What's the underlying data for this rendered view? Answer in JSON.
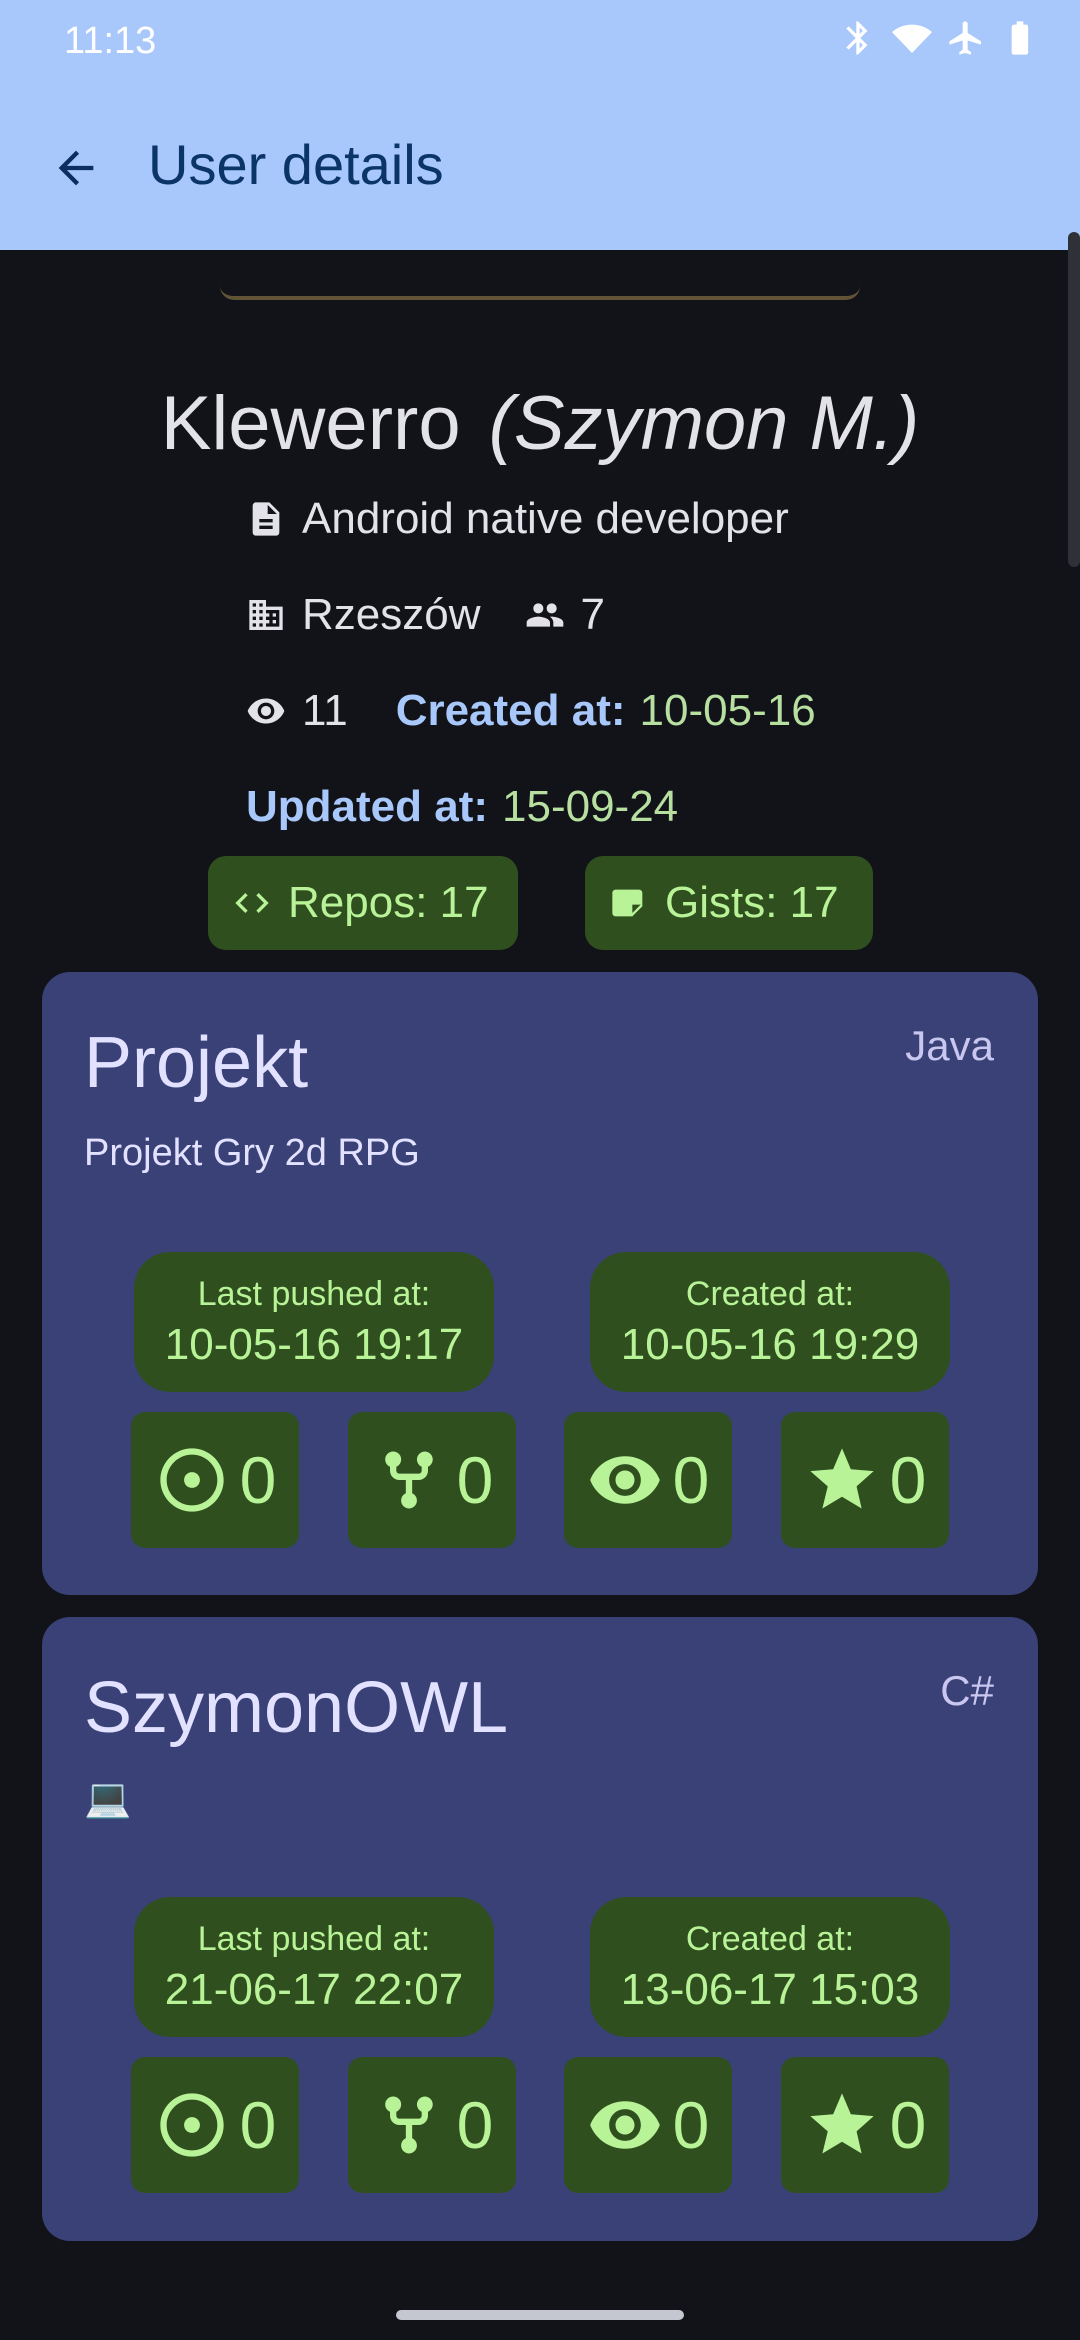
{
  "status_bar": {
    "time": "11:13",
    "icons": [
      "bluetooth-icon",
      "wifi-icon",
      "airplane-icon",
      "battery-icon"
    ]
  },
  "appbar": {
    "title": "User details"
  },
  "profile": {
    "login": "Klewerro",
    "real_name": "(Szymon M.)",
    "bio": "Android native developer",
    "location": "Rzeszów",
    "followers": "7",
    "following": "11",
    "created_label": "Created at:",
    "created_value": "10-05-16",
    "updated_label": "Updated at:",
    "updated_value": "15-09-24",
    "repos_chip": "Repos: 17",
    "gists_chip": "Gists: 17"
  },
  "repos": [
    {
      "name": "Projekt",
      "language": "Java",
      "description": "Projekt Gry 2d RPG",
      "last_pushed_label": "Last pushed at:",
      "last_pushed": "10-05-16 19:17",
      "created_label": "Created at:",
      "created": "10-05-16 19:29",
      "issues": "0",
      "forks": "0",
      "watchers": "0",
      "stars": "0"
    },
    {
      "name": "SzymonOWL",
      "language": "C#",
      "description": "💻",
      "last_pushed_label": "Last pushed at:",
      "last_pushed": "21-06-17 22:07",
      "created_label": "Created at:",
      "created": "13-06-17 15:03",
      "issues": "0",
      "forks": "0",
      "watchers": "0",
      "stars": "0"
    }
  ],
  "colors": {
    "appbar": "#a8c7fa",
    "background": "#111318",
    "card": "#3a4177",
    "chip": "#2f4f1f",
    "chip_text": "#b8f397",
    "label": "#a8c7fa"
  }
}
